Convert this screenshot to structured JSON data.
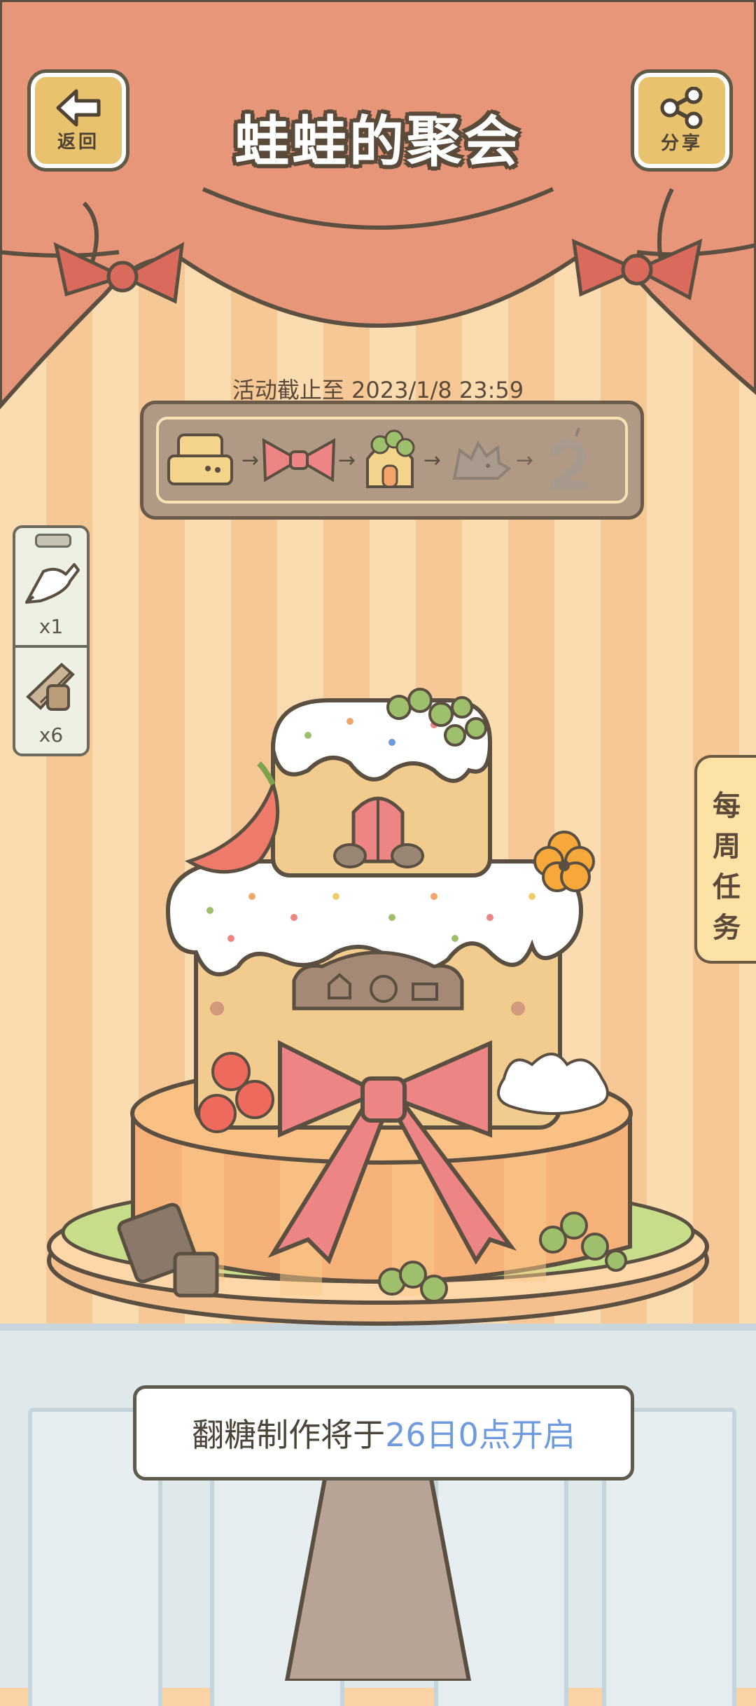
{
  "header": {
    "title": "蛙蛙的聚会",
    "back_label": "返回",
    "share_label": "分享"
  },
  "event": {
    "deadline": "活动截止至 2023/1/8 23:59"
  },
  "progress_steps": [
    "cake-base",
    "bow",
    "clover-house",
    "hedgehog",
    "number-2"
  ],
  "sidebar": {
    "items": [
      {
        "icon": "piping-bag-icon",
        "count": "x1"
      },
      {
        "icon": "tools-bundle-icon",
        "count": "x6"
      }
    ]
  },
  "weekly_tasks": {
    "label": "每周任务"
  },
  "notice": {
    "prefix": "翻糖制作将于",
    "highlight": "26日0点开启"
  },
  "colors": {
    "curtain": "#e8967a",
    "accent_blue": "#6e9ae0",
    "bow": "#ee8585"
  }
}
